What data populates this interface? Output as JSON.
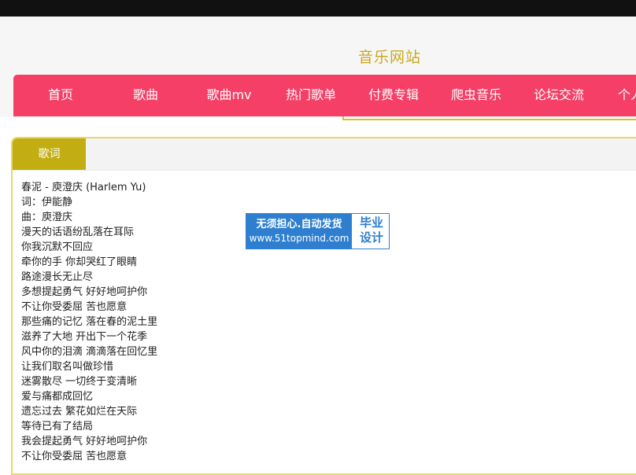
{
  "site": {
    "title": "音乐网站"
  },
  "nav": {
    "items": [
      {
        "label": "首页"
      },
      {
        "label": "歌曲"
      },
      {
        "label": "歌曲mv"
      },
      {
        "label": "热门歌单"
      },
      {
        "label": "付费专辑"
      },
      {
        "label": "爬虫音乐"
      },
      {
        "label": "论坛交流"
      },
      {
        "label": "个人"
      }
    ]
  },
  "panel": {
    "tab_label": "歌词"
  },
  "lyrics": [
    "春泥 - 庾澄庆 (Harlem Yu)",
    "词：伊能静",
    "曲：庾澄庆",
    "漫天的话语纷乱落在耳际",
    "你我沉默不回应",
    "牵你的手 你却哭红了眼睛",
    "路途漫长无止尽",
    "多想提起勇气 好好地呵护你",
    "不让你受委屈 苦也愿意",
    "那些痛的记忆 落在春的泥土里",
    "滋养了大地 开出下一个花季",
    "风中你的泪滴 滴滴落在回忆里",
    "让我们取名叫做珍惜",
    "迷雾散尽 一切终于变清晰",
    "爱与痛都成回忆",
    "遗忘过去 繁花如烂在天际",
    "等待已有了结局",
    "我会提起勇气 好好地呵护你",
    "不让你受委屈 苦也愿意"
  ],
  "watermark": {
    "line1": "无须担心.自动发货",
    "line2": "www.51topmind.com",
    "right_line1": "毕业",
    "right_line2": "设计"
  }
}
